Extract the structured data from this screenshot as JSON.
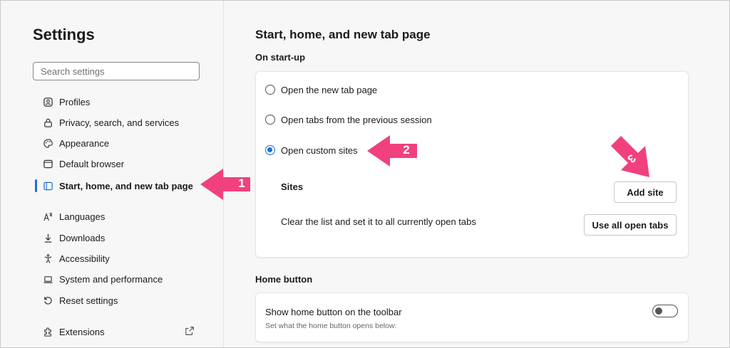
{
  "sidebar": {
    "title": "Settings",
    "search_placeholder": "Search settings",
    "items": [
      {
        "label": "Profiles",
        "icon": "profile-icon"
      },
      {
        "label": "Privacy, search, and services",
        "icon": "lock-icon"
      },
      {
        "label": "Appearance",
        "icon": "palette-icon"
      },
      {
        "label": "Default browser",
        "icon": "browser-icon"
      },
      {
        "label": "Start, home, and new tab page",
        "icon": "start-page-icon",
        "active": true
      },
      {
        "label": "Languages",
        "icon": "languages-icon"
      },
      {
        "label": "Downloads",
        "icon": "download-icon"
      },
      {
        "label": "Accessibility",
        "icon": "accessibility-icon"
      },
      {
        "label": "System and performance",
        "icon": "laptop-icon"
      },
      {
        "label": "Reset settings",
        "icon": "reset-icon"
      },
      {
        "label": "Extensions",
        "icon": "puzzle-icon",
        "external": true
      }
    ]
  },
  "main": {
    "title": "Start, home, and new tab page",
    "startup": {
      "label": "On start-up",
      "options": [
        {
          "label": "Open the new tab page",
          "selected": false
        },
        {
          "label": "Open tabs from the previous session",
          "selected": false
        },
        {
          "label": "Open custom sites",
          "selected": true
        }
      ],
      "sites_label": "Sites",
      "add_site_button": "Add site",
      "clear_text": "Clear the list and set it to all currently open tabs",
      "use_all_tabs_button": "Use all open tabs"
    },
    "home_button": {
      "label": "Home button",
      "toggle_label": "Show home button on the toolbar",
      "toggle_description": "Set what the home button opens below:",
      "toggle_on": false
    }
  },
  "annotations": [
    {
      "number": "1"
    },
    {
      "number": "2"
    },
    {
      "number": "3"
    }
  ],
  "colors": {
    "accent": "#1a6fd8",
    "annotation": "#f0417e",
    "background": "#f7f7f7"
  }
}
